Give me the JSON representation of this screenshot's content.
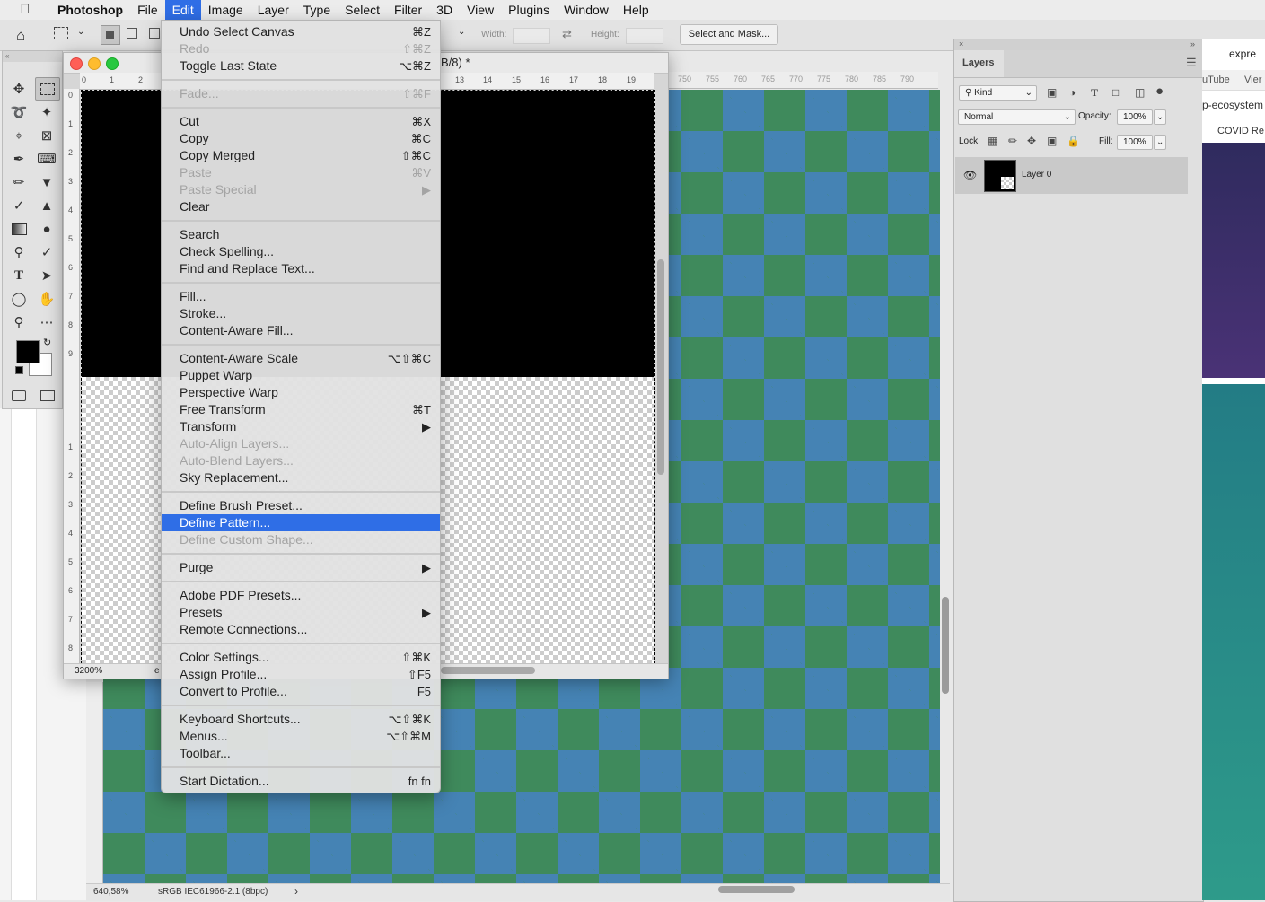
{
  "menubar": {
    "apple": "",
    "app": "Photoshop",
    "items": [
      "File",
      "Edit",
      "Image",
      "Layer",
      "Type",
      "Select",
      "Filter",
      "3D",
      "View",
      "Plugins",
      "Window",
      "Help"
    ],
    "active": "Edit"
  },
  "options_bar": {
    "width_label": "Width:",
    "height_label": "Height:",
    "select_and_mask": "Select and Mask..."
  },
  "document": {
    "title_suffix": "B/8) *",
    "ruler_top": [
      "0",
      "1",
      "2",
      "13",
      "14",
      "15",
      "16",
      "17",
      "18",
      "19"
    ],
    "ruler_left": [
      "0",
      "1",
      "2",
      "3",
      "4",
      "5",
      "6",
      "7",
      "8",
      "9",
      "1",
      "2",
      "3",
      "4",
      "5",
      "6",
      "7",
      "8",
      "9"
    ],
    "zoom": "3200%",
    "status_fragment": "e"
  },
  "background_document": {
    "ruler_top": [
      "750",
      "755",
      "760",
      "765",
      "770",
      "775",
      "780",
      "785",
      "790"
    ],
    "zoom": "640,58%",
    "profile": "sRGB IEC61966-2.1 (8bpc)",
    "arrow": "›"
  },
  "edit_menu": {
    "items": [
      {
        "label": "Undo Select Canvas",
        "shortcut": "⌘Z",
        "disabled": false
      },
      {
        "label": "Redo",
        "shortcut": "⇧⌘Z",
        "disabled": true
      },
      {
        "label": "Toggle Last State",
        "shortcut": "⌥⌘Z",
        "disabled": false
      },
      {
        "sep": true
      },
      {
        "label": "Fade...",
        "shortcut": "⇧⌘F",
        "disabled": true
      },
      {
        "sep": true
      },
      {
        "label": "Cut",
        "shortcut": "⌘X",
        "disabled": false
      },
      {
        "label": "Copy",
        "shortcut": "⌘C",
        "disabled": false
      },
      {
        "label": "Copy Merged",
        "shortcut": "⇧⌘C",
        "disabled": false
      },
      {
        "label": "Paste",
        "shortcut": "⌘V",
        "disabled": true
      },
      {
        "label": "Paste Special",
        "shortcut": "▶",
        "disabled": true
      },
      {
        "label": "Clear",
        "shortcut": "",
        "disabled": false
      },
      {
        "sep": true
      },
      {
        "label": "Search",
        "shortcut": "",
        "disabled": false
      },
      {
        "label": "Check Spelling...",
        "shortcut": "",
        "disabled": false
      },
      {
        "label": "Find and Replace Text...",
        "shortcut": "",
        "disabled": false
      },
      {
        "sep": true
      },
      {
        "label": "Fill...",
        "shortcut": "",
        "disabled": false
      },
      {
        "label": "Stroke...",
        "shortcut": "",
        "disabled": false
      },
      {
        "label": "Content-Aware Fill...",
        "shortcut": "",
        "disabled": false
      },
      {
        "sep": true
      },
      {
        "label": "Content-Aware Scale",
        "shortcut": "⌥⇧⌘C",
        "disabled": false
      },
      {
        "label": "Puppet Warp",
        "shortcut": "",
        "disabled": false
      },
      {
        "label": "Perspective Warp",
        "shortcut": "",
        "disabled": false
      },
      {
        "label": "Free Transform",
        "shortcut": "⌘T",
        "disabled": false
      },
      {
        "label": "Transform",
        "shortcut": "▶",
        "disabled": false
      },
      {
        "label": "Auto-Align Layers...",
        "shortcut": "",
        "disabled": true
      },
      {
        "label": "Auto-Blend Layers...",
        "shortcut": "",
        "disabled": true
      },
      {
        "label": "Sky Replacement...",
        "shortcut": "",
        "disabled": false
      },
      {
        "sep": true
      },
      {
        "label": "Define Brush Preset...",
        "shortcut": "",
        "disabled": false
      },
      {
        "label": "Define Pattern...",
        "shortcut": "",
        "disabled": false,
        "highlighted": true
      },
      {
        "label": "Define Custom Shape...",
        "shortcut": "",
        "disabled": true
      },
      {
        "sep": true
      },
      {
        "label": "Purge",
        "shortcut": "▶",
        "disabled": false
      },
      {
        "sep": true
      },
      {
        "label": "Adobe PDF Presets...",
        "shortcut": "",
        "disabled": false
      },
      {
        "label": "Presets",
        "shortcut": "▶",
        "disabled": false
      },
      {
        "label": "Remote Connections...",
        "shortcut": "",
        "disabled": false
      },
      {
        "sep": true
      },
      {
        "label": "Color Settings...",
        "shortcut": "⇧⌘K",
        "disabled": false
      },
      {
        "label": "Assign Profile...",
        "shortcut": "⇧F5",
        "disabled": false
      },
      {
        "label": "Convert to Profile...",
        "shortcut": "F5",
        "disabled": false
      },
      {
        "sep": true
      },
      {
        "label": "Keyboard Shortcuts...",
        "shortcut": "⌥⇧⌘K",
        "disabled": false
      },
      {
        "label": "Menus...",
        "shortcut": "⌥⇧⌘M",
        "disabled": false
      },
      {
        "label": "Toolbar...",
        "shortcut": "",
        "disabled": false
      },
      {
        "sep": true
      },
      {
        "label": "Start Dictation...",
        "shortcut": "fn fn",
        "disabled": false
      }
    ]
  },
  "layers_panel": {
    "tab": "Layers",
    "kind": "Kind",
    "blend_mode": "Normal",
    "opacity_label": "Opacity:",
    "opacity": "100%",
    "lock_label": "Lock:",
    "fill_label": "Fill:",
    "fill": "100%",
    "layer_name": "Layer 0"
  },
  "browser_fragment": {
    "top_text": "expre",
    "tab_youtube": "uTube",
    "tab_view": "Vier",
    "ecosystem": "p-ecosystem",
    "covid": "COVID Re"
  },
  "colors": {
    "accent": "#2f6ee6",
    "checker_green": "#3f8a5c",
    "checker_blue": "#4682be"
  }
}
